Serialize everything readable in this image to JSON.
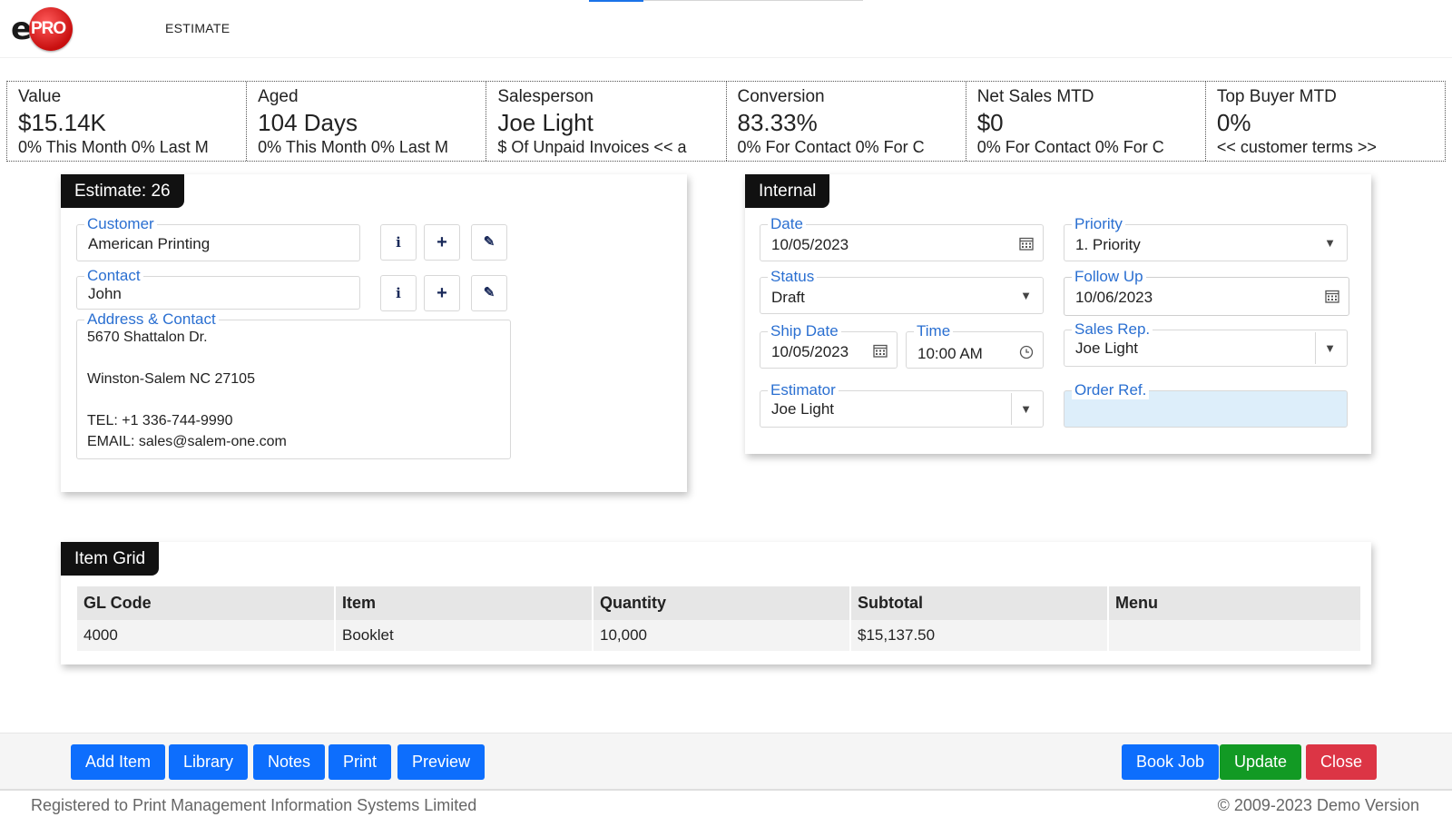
{
  "header": {
    "logo_text_e": "e",
    "logo_text_pro": "PRO",
    "title": "ESTIMATE"
  },
  "kpis": [
    {
      "label": "Value",
      "value": "$15.14K",
      "sub": "0% This Month 0% Last M"
    },
    {
      "label": "Aged",
      "value": "104 Days",
      "sub": "0% This Month 0% Last M"
    },
    {
      "label": "Salesperson",
      "value": "Joe Light",
      "sub": "$ Of Unpaid Invoices << a"
    },
    {
      "label": "Conversion",
      "value": "83.33%",
      "sub": "0% For Contact 0% For C"
    },
    {
      "label": "Net Sales MTD",
      "value": "$0",
      "sub": "0% For Contact 0% For C"
    },
    {
      "label": "Top Buyer MTD",
      "value": "0%",
      "sub": "<< customer terms >>"
    }
  ],
  "estimate_panel": {
    "tab": "Estimate: 26",
    "customer": {
      "label": "Customer",
      "value": "American Printing"
    },
    "contact": {
      "label": "Contact",
      "value": "John"
    },
    "address": {
      "label": "Address & Contact",
      "lines": [
        "5670 Shattalon Dr.",
        "Winston-Salem NC  27105",
        "TEL: +1 336-744-9990",
        "EMAIL: sales@salem-one.com"
      ]
    },
    "icon_info": "i",
    "icon_add": "+",
    "icon_edit": "✎"
  },
  "internal_panel": {
    "tab": "Internal",
    "date": {
      "label": "Date",
      "value": "10/05/2023"
    },
    "priority": {
      "label": "Priority",
      "value": "1. Priority"
    },
    "status": {
      "label": "Status",
      "value": "Draft"
    },
    "follow_up": {
      "label": "Follow Up",
      "value": "10/06/2023"
    },
    "ship_date": {
      "label": "Ship Date",
      "value": "10/05/2023"
    },
    "time": {
      "label": "Time",
      "value": "10:00 AM"
    },
    "sales_rep": {
      "label": "Sales Rep.",
      "value": "Joe Light"
    },
    "estimator": {
      "label": "Estimator",
      "value": "Joe Light"
    },
    "order_ref": {
      "label": "Order Ref.",
      "value": ""
    }
  },
  "item_grid": {
    "tab": "Item Grid",
    "columns": [
      "GL Code",
      "Item",
      "Quantity",
      "Subtotal",
      "Menu"
    ],
    "rows": [
      [
        "4000",
        "Booklet",
        "10,000",
        "$15,137.50",
        ""
      ]
    ]
  },
  "actions": {
    "add_item": "Add Item",
    "library": "Library",
    "notes": "Notes",
    "print": "Print",
    "preview": "Preview",
    "book_job": "Book Job",
    "update": "Update",
    "close": "Close"
  },
  "footer": {
    "left": "Registered to Print Management Information Systems Limited",
    "right": "© 2009-2023 Demo Version"
  },
  "colors": {
    "primary": "#0d6efd",
    "success": "#129a24",
    "danger": "#dc3545",
    "label_blue": "#2a6fd1",
    "order_ref_bg": "#ddeefa"
  },
  "caret_glyph": "▼"
}
